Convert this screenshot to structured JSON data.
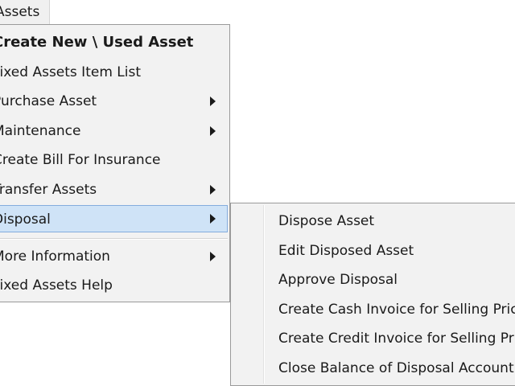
{
  "menubar": {
    "title": "Assets"
  },
  "main_menu": {
    "items": [
      {
        "label": "Create New \\ Used Asset",
        "bold": true,
        "submenu": false
      },
      {
        "label": "Fixed Assets Item List",
        "submenu": false
      },
      {
        "label": "Purchase Asset",
        "submenu": true
      },
      {
        "label": "Maintenance",
        "submenu": true
      },
      {
        "label": "Create Bill For Insurance",
        "submenu": false
      },
      {
        "label": "Transfer Assets",
        "submenu": true
      },
      {
        "label": "Disposal",
        "submenu": true,
        "highlighted": true
      },
      {
        "label": "More Information",
        "submenu": true
      },
      {
        "label": "Fixed Assets Help",
        "submenu": false
      }
    ]
  },
  "disposal_submenu": {
    "items": [
      {
        "label": "Dispose Asset"
      },
      {
        "label": "Edit Disposed Asset"
      },
      {
        "label": "Approve Disposal"
      },
      {
        "label": "Create Cash Invoice for Selling Price"
      },
      {
        "label": "Create Credit Invoice for Selling Price"
      },
      {
        "label": "Close Balance of Disposal Account"
      }
    ]
  },
  "colors": {
    "menu_background": "#f2f2f2",
    "highlight_fill": "#cfe3f7",
    "highlight_border": "#84acdd",
    "menu_border": "#9a9a9a"
  }
}
